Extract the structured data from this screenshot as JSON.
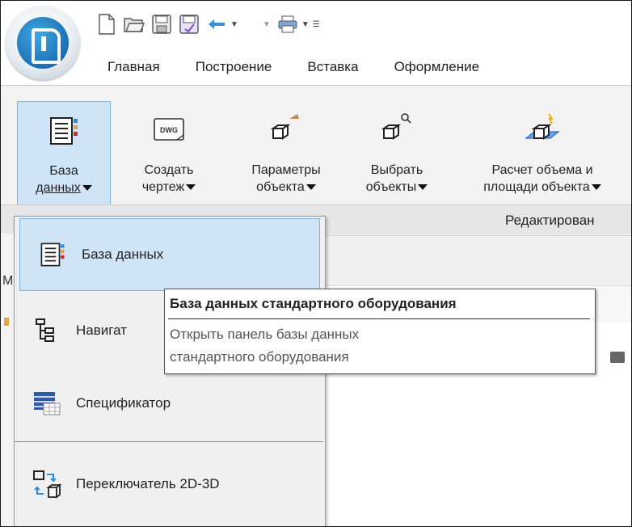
{
  "tabs": [
    "Главная",
    "Построение",
    "Вставка",
    "Оформление"
  ],
  "ribbon": {
    "database_btn": {
      "line1": "База",
      "line2": "данных"
    },
    "create_drawing_btn": {
      "line1": "Создать",
      "line2": "чертеж",
      "icon_text": "DWG"
    },
    "object_params_btn": {
      "line1": "Параметры",
      "line2": "объекта"
    },
    "select_objects_btn": {
      "line1": "Выбрать",
      "line2": "объекты"
    },
    "volume_calc_btn": {
      "line1": "Расчет объема и",
      "line2": "площади объекта"
    },
    "group_label": "Редактирован"
  },
  "menu": {
    "items": [
      {
        "label": "База данных"
      },
      {
        "label": "Навигат"
      },
      {
        "label": "Спецификатор"
      },
      {
        "label": "Переключатель 2D-3D"
      }
    ]
  },
  "tooltip": {
    "title": "База данных стандартного оборудования",
    "line1": "Открыть панель базы данных",
    "line2": "стандартного оборудования"
  },
  "edge": {
    "letter": "М"
  },
  "colors": {
    "accent": "#cfe4f7",
    "accent_border": "#7fb1e0",
    "app_blue": "#1d6fb6"
  }
}
